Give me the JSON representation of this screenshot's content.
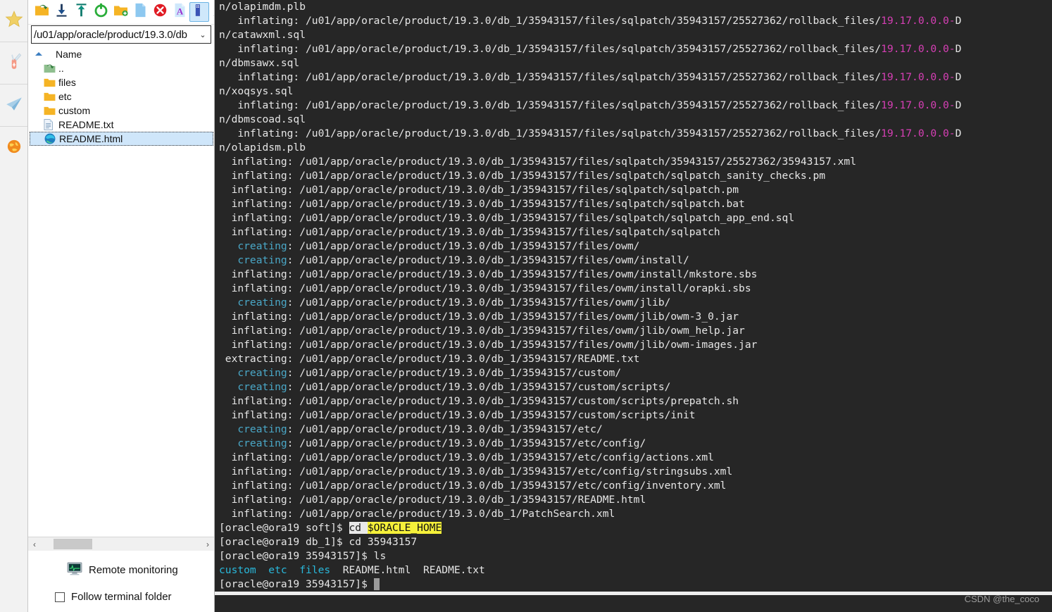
{
  "rail": {
    "items": [
      {
        "name": "favorites",
        "icon": "star-icon"
      },
      {
        "name": "tools",
        "icon": "knife-icon"
      },
      {
        "name": "sessions",
        "icon": "paper-plane-icon"
      },
      {
        "name": "browser",
        "icon": "globe-icon"
      }
    ]
  },
  "sftp": {
    "toolbar": [
      {
        "name": "go-up-folder",
        "icon": "folder-up-icon",
        "selected": false
      },
      {
        "name": "download",
        "icon": "download-arrow-icon",
        "selected": false
      },
      {
        "name": "upload",
        "icon": "upload-arrow-icon",
        "selected": false
      },
      {
        "name": "refresh",
        "icon": "refresh-icon",
        "selected": false
      },
      {
        "name": "new-folder",
        "icon": "new-folder-icon",
        "selected": false
      },
      {
        "name": "new-file",
        "icon": "new-file-icon",
        "selected": false
      },
      {
        "name": "delete",
        "icon": "delete-circle-icon",
        "selected": false
      },
      {
        "name": "text-mode",
        "icon": "font-a-icon",
        "selected": false
      },
      {
        "name": "binary-mode",
        "icon": "binary-file-icon",
        "selected": true
      },
      {
        "name": "edit",
        "icon": "pencil-icon",
        "selected": false
      }
    ],
    "path": "/u01/app/oracle/product/19.3.0/db",
    "path_caret": "⌄",
    "column_header": "Name",
    "files": [
      {
        "name": "..",
        "icon": "parent-folder-icon",
        "selected": false
      },
      {
        "name": "files",
        "icon": "folder-icon",
        "selected": false
      },
      {
        "name": "etc",
        "icon": "folder-icon",
        "selected": false
      },
      {
        "name": "custom",
        "icon": "folder-icon",
        "selected": false
      },
      {
        "name": "README.txt",
        "icon": "text-file-icon",
        "selected": false
      },
      {
        "name": "README.html",
        "icon": "edge-browser-icon",
        "selected": true
      }
    ],
    "scroll_left_arrow": "‹",
    "scroll_right_arrow": "›",
    "remote_monitoring_label": "Remote monitoring",
    "follow_terminal_folder_label": "Follow terminal folder",
    "follow_terminal_folder_checked": false
  },
  "terminal": {
    "colors": {
      "background": "#262626",
      "text": "#e6e6e6",
      "creating": "#4aa8c8",
      "magenta": "#d63fb5",
      "ls_dir": "#29b8db",
      "highlight_bg": "#f5f03a",
      "selection_bg": "#e9e9e9"
    },
    "lines": [
      {
        "segs": [
          {
            "t": "n/olapimdm.plb",
            "c": "w"
          }
        ]
      },
      {
        "segs": [
          {
            "t": "   inflating: /u01/app/oracle/product/19.3.0/db_1/35943157/files/sqlpatch/35943157/25527362/rollback_files/",
            "c": "w"
          },
          {
            "t": "19.17.0.0.0-",
            "c": "mag"
          },
          {
            "t": "D",
            "c": "w"
          }
        ]
      },
      {
        "segs": [
          {
            "t": "n/catawxml.sql",
            "c": "w"
          }
        ]
      },
      {
        "segs": [
          {
            "t": "   inflating: /u01/app/oracle/product/19.3.0/db_1/35943157/files/sqlpatch/35943157/25527362/rollback_files/",
            "c": "w"
          },
          {
            "t": "19.17.0.0.0-",
            "c": "mag"
          },
          {
            "t": "D",
            "c": "w"
          }
        ]
      },
      {
        "segs": [
          {
            "t": "n/dbmsawx.sql",
            "c": "w"
          }
        ]
      },
      {
        "segs": [
          {
            "t": "   inflating: /u01/app/oracle/product/19.3.0/db_1/35943157/files/sqlpatch/35943157/25527362/rollback_files/",
            "c": "w"
          },
          {
            "t": "19.17.0.0.0-",
            "c": "mag"
          },
          {
            "t": "D",
            "c": "w"
          }
        ]
      },
      {
        "segs": [
          {
            "t": "n/xoqsys.sql",
            "c": "w"
          }
        ]
      },
      {
        "segs": [
          {
            "t": "   inflating: /u01/app/oracle/product/19.3.0/db_1/35943157/files/sqlpatch/35943157/25527362/rollback_files/",
            "c": "w"
          },
          {
            "t": "19.17.0.0.0-",
            "c": "mag"
          },
          {
            "t": "D",
            "c": "w"
          }
        ]
      },
      {
        "segs": [
          {
            "t": "n/dbmscoad.sql",
            "c": "w"
          }
        ]
      },
      {
        "segs": [
          {
            "t": "   inflating: /u01/app/oracle/product/19.3.0/db_1/35943157/files/sqlpatch/35943157/25527362/rollback_files/",
            "c": "w"
          },
          {
            "t": "19.17.0.0.0-",
            "c": "mag"
          },
          {
            "t": "D",
            "c": "w"
          }
        ]
      },
      {
        "segs": [
          {
            "t": "n/olapidsm.plb",
            "c": "w"
          }
        ]
      },
      {
        "segs": [
          {
            "t": "  inflating: /u01/app/oracle/product/19.3.0/db_1/35943157/files/sqlpatch/35943157/25527362/35943157.xml",
            "c": "w"
          }
        ]
      },
      {
        "segs": [
          {
            "t": "  inflating: /u01/app/oracle/product/19.3.0/db_1/35943157/files/sqlpatch/sqlpatch_sanity_checks.pm",
            "c": "w"
          }
        ]
      },
      {
        "segs": [
          {
            "t": "  inflating: /u01/app/oracle/product/19.3.0/db_1/35943157/files/sqlpatch/sqlpatch.pm",
            "c": "w"
          }
        ]
      },
      {
        "segs": [
          {
            "t": "  inflating: /u01/app/oracle/product/19.3.0/db_1/35943157/files/sqlpatch/sqlpatch.bat",
            "c": "w"
          }
        ]
      },
      {
        "segs": [
          {
            "t": "  inflating: /u01/app/oracle/product/19.3.0/db_1/35943157/files/sqlpatch/sqlpatch_app_end.sql",
            "c": "w"
          }
        ]
      },
      {
        "segs": [
          {
            "t": "  inflating: /u01/app/oracle/product/19.3.0/db_1/35943157/files/sqlpatch/sqlpatch",
            "c": "w"
          }
        ]
      },
      {
        "segs": [
          {
            "t": "   creating",
            "c": "cy"
          },
          {
            "t": ": /u01/app/oracle/product/19.3.0/db_1/35943157/files/owm/",
            "c": "w"
          }
        ]
      },
      {
        "segs": [
          {
            "t": "   creating",
            "c": "cy"
          },
          {
            "t": ": /u01/app/oracle/product/19.3.0/db_1/35943157/files/owm/install/",
            "c": "w"
          }
        ]
      },
      {
        "segs": [
          {
            "t": "  inflating: /u01/app/oracle/product/19.3.0/db_1/35943157/files/owm/install/mkstore.sbs",
            "c": "w"
          }
        ]
      },
      {
        "segs": [
          {
            "t": "  inflating: /u01/app/oracle/product/19.3.0/db_1/35943157/files/owm/install/orapki.sbs",
            "c": "w"
          }
        ]
      },
      {
        "segs": [
          {
            "t": "   creating",
            "c": "cy"
          },
          {
            "t": ": /u01/app/oracle/product/19.3.0/db_1/35943157/files/owm/jlib/",
            "c": "w"
          }
        ]
      },
      {
        "segs": [
          {
            "t": "  inflating: /u01/app/oracle/product/19.3.0/db_1/35943157/files/owm/jlib/owm-3_0.jar",
            "c": "w"
          }
        ]
      },
      {
        "segs": [
          {
            "t": "  inflating: /u01/app/oracle/product/19.3.0/db_1/35943157/files/owm/jlib/owm_help.jar",
            "c": "w"
          }
        ]
      },
      {
        "segs": [
          {
            "t": "  inflating: /u01/app/oracle/product/19.3.0/db_1/35943157/files/owm/jlib/owm-images.jar",
            "c": "w"
          }
        ]
      },
      {
        "segs": [
          {
            "t": " extracting: /u01/app/oracle/product/19.3.0/db_1/35943157/README.txt",
            "c": "w"
          }
        ]
      },
      {
        "segs": [
          {
            "t": "   creating",
            "c": "cy"
          },
          {
            "t": ": /u01/app/oracle/product/19.3.0/db_1/35943157/custom/",
            "c": "w"
          }
        ]
      },
      {
        "segs": [
          {
            "t": "   creating",
            "c": "cy"
          },
          {
            "t": ": /u01/app/oracle/product/19.3.0/db_1/35943157/custom/scripts/",
            "c": "w"
          }
        ]
      },
      {
        "segs": [
          {
            "t": "  inflating: /u01/app/oracle/product/19.3.0/db_1/35943157/custom/scripts/prepatch.sh",
            "c": "w"
          }
        ]
      },
      {
        "segs": [
          {
            "t": "  inflating: /u01/app/oracle/product/19.3.0/db_1/35943157/custom/scripts/init",
            "c": "w"
          }
        ]
      },
      {
        "segs": [
          {
            "t": "   creating",
            "c": "cy"
          },
          {
            "t": ": /u01/app/oracle/product/19.3.0/db_1/35943157/etc/",
            "c": "w"
          }
        ]
      },
      {
        "segs": [
          {
            "t": "   creating",
            "c": "cy"
          },
          {
            "t": ": /u01/app/oracle/product/19.3.0/db_1/35943157/etc/config/",
            "c": "w"
          }
        ]
      },
      {
        "segs": [
          {
            "t": "  inflating: /u01/app/oracle/product/19.3.0/db_1/35943157/etc/config/actions.xml",
            "c": "w"
          }
        ]
      },
      {
        "segs": [
          {
            "t": "  inflating: /u01/app/oracle/product/19.3.0/db_1/35943157/etc/config/stringsubs.xml",
            "c": "w"
          }
        ]
      },
      {
        "segs": [
          {
            "t": "  inflating: /u01/app/oracle/product/19.3.0/db_1/35943157/etc/config/inventory.xml",
            "c": "w"
          }
        ]
      },
      {
        "segs": [
          {
            "t": "  inflating: /u01/app/oracle/product/19.3.0/db_1/35943157/README.html",
            "c": "w"
          }
        ]
      },
      {
        "segs": [
          {
            "t": "  inflating: /u01/app/oracle/product/19.3.0/db_1/PatchSearch.xml",
            "c": "w"
          }
        ]
      },
      {
        "segs": [
          {
            "t": "[oracle@ora19 soft]$ ",
            "c": "w"
          },
          {
            "t": "cd ",
            "c": "sel"
          },
          {
            "t": "$ORACLE_HOME",
            "c": "hl"
          }
        ]
      },
      {
        "segs": [
          {
            "t": "[oracle@ora19 db_1]$ cd 35943157",
            "c": "w"
          }
        ]
      },
      {
        "segs": [
          {
            "t": "[oracle@ora19 35943157]$ ls",
            "c": "w"
          }
        ]
      },
      {
        "segs": [
          {
            "t": "custom  etc  files",
            "c": "ls"
          },
          {
            "t": "  README.html  README.txt",
            "c": "w"
          }
        ]
      },
      {
        "segs": [
          {
            "t": "[oracle@ora19 35943157]$ ",
            "c": "w"
          },
          {
            "t": " ",
            "c": "cur"
          }
        ]
      }
    ],
    "watermark": "CSDN @the_coco"
  }
}
